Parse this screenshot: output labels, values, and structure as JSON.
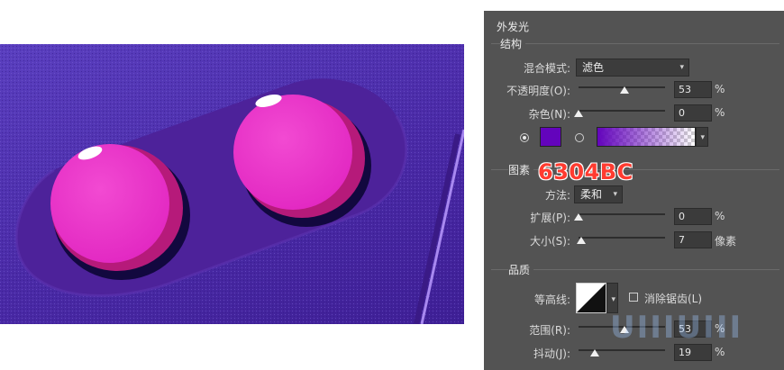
{
  "panel": {
    "title": "外发光",
    "structure": {
      "label": "结构",
      "blend_mode_label": "混合模式:",
      "blend_mode_value": "滤色",
      "opacity_label": "不透明度(O):",
      "opacity_value": "53",
      "opacity_level": 0.53,
      "opacity_unit": "%",
      "noise_label": "杂色(N):",
      "noise_value": "0",
      "noise_level": 0,
      "noise_unit": "%",
      "glow_color": "#6304BC"
    },
    "elements": {
      "label": "图素",
      "annotation": "6304BC",
      "method_label": "方法:",
      "method_value": "柔和",
      "spread_label": "扩展(P):",
      "spread_value": "0",
      "spread_level": 0,
      "spread_unit": "%",
      "size_label": "大小(S):",
      "size_value": "7",
      "size_level": 0.03,
      "size_unit": "像素"
    },
    "quality": {
      "label": "品质",
      "contour_label": "等高线:",
      "antialias_label": "消除锯齿(L)",
      "antialias_checked": false,
      "range_label": "范围(R):",
      "range_value": "53",
      "range_level": 0.53,
      "range_unit": "%",
      "jitter_label": "抖动(J):",
      "jitter_value": "19",
      "jitter_level": 0.19,
      "jitter_unit": "%"
    }
  },
  "watermark": "UIIIUIII",
  "colors": {
    "panel_bg": "#535353",
    "annotation": "#ff3b30",
    "button_pink": "#e82bc4",
    "housing": "#4a1f94"
  }
}
